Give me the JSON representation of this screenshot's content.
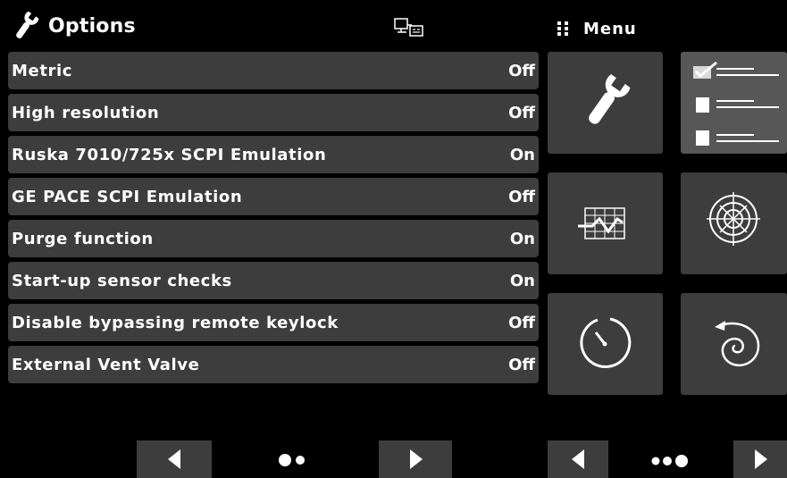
{
  "header": {
    "title": "Options",
    "title_icon": "wrench-icon",
    "status_icon": "remote-connection-icon"
  },
  "options": [
    {
      "label": "Metric",
      "value": "Off"
    },
    {
      "label": "High resolution",
      "value": "Off"
    },
    {
      "label": "Ruska 7010/725x SCPI Emulation",
      "value": "On"
    },
    {
      "label": "GE PACE SCPI Emulation",
      "value": "Off"
    },
    {
      "label": "Purge function",
      "value": "On"
    },
    {
      "label": "Start-up sensor checks",
      "value": "On"
    },
    {
      "label": "Disable bypassing remote keylock",
      "value": "Off"
    },
    {
      "label": "External Vent Valve",
      "value": "Off"
    }
  ],
  "menu": {
    "title": "Menu",
    "title_icon": "grid-dots-icon",
    "tiles": [
      {
        "icon": "wrench-icon",
        "selected": false
      },
      {
        "icon": "checklist-icon",
        "selected": true
      },
      {
        "icon": "trend-chart-icon",
        "selected": false
      },
      {
        "icon": "target-icon",
        "selected": false
      },
      {
        "icon": "timer-icon",
        "selected": false
      },
      {
        "icon": "spiral-icon",
        "selected": false
      }
    ]
  },
  "options_pager": {
    "prev_icon": "arrow-left-icon",
    "next_icon": "arrow-right-icon",
    "pages": 2
  },
  "menu_pager": {
    "prev_icon": "arrow-left-icon",
    "next_icon": "arrow-right-icon",
    "pages": 3
  },
  "colors": {
    "background": "#000000",
    "row_background": "#3d3d3d",
    "text": "#ffffff"
  }
}
